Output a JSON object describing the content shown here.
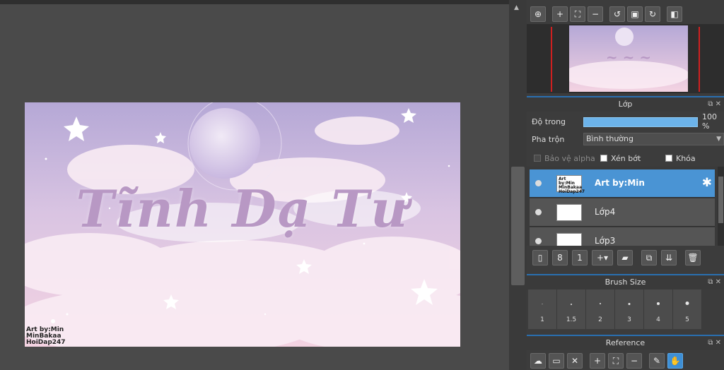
{
  "artwork": {
    "title": "Tĩnh Dạ Tư",
    "credit_lines": [
      "Art by:Min",
      "MinBakaa",
      "HoiDap247"
    ]
  },
  "navigator_toolbar": {
    "icons": [
      "zoom-fit-icon",
      "zoom-in-icon",
      "fit-screen-icon",
      "zoom-out-icon",
      "rotate-left-icon",
      "fullscreen-icon",
      "rotate-right-icon",
      "flip-icon"
    ]
  },
  "layer_panel": {
    "title": "Lớp",
    "opacity_label": "Độ trong",
    "opacity_value": "100 %",
    "opacity_fraction": 1.0,
    "blend_label": "Pha trộn",
    "blend_value": "Bình thường",
    "protect_alpha_label": "Bảo vệ alpha",
    "clipping_label": "Xén bớt",
    "lock_label": "Khóa",
    "layers": [
      {
        "name": "Art by:Min",
        "selected": true,
        "thumb_text": [
          "Art by:Min",
          "MinBakaa",
          "HoiDap247"
        ]
      },
      {
        "name": "Lớp4",
        "selected": false
      },
      {
        "name": "Lớp3",
        "selected": false
      }
    ]
  },
  "brush_panel": {
    "title": "Brush Size",
    "sizes": [
      "1",
      "1.5",
      "2",
      "3",
      "4",
      "5"
    ]
  },
  "reference_panel": {
    "title": "Reference"
  },
  "colors": {
    "accent": "#3d8fd6",
    "panel_bg": "#3c3c3c",
    "selected_layer": "#4a94d4",
    "title_text": "#b898c4"
  }
}
